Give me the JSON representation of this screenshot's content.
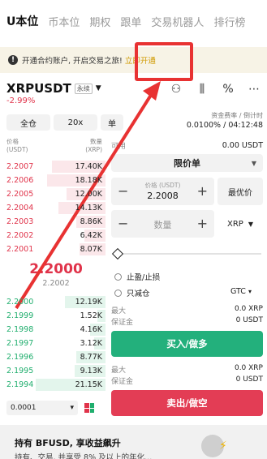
{
  "tabs": [
    "U本位",
    "币本位",
    "期权",
    "跟单",
    "交易机器人",
    "排行榜"
  ],
  "notice": {
    "text": "开通合约账户, 开启交易之旅!",
    "link": "立即开通"
  },
  "pair": {
    "symbol": "XRPUSDT",
    "type": "永续",
    "change": "-2.99%"
  },
  "controls": {
    "margin_mode": "全仓",
    "leverage": "20x",
    "position_mode": "单"
  },
  "funding": {
    "label": "资金费率 / 倒计时",
    "value": "0.0100% / 04:12:48"
  },
  "balance": {
    "label": "可用",
    "value": "0.00 USDT"
  },
  "orderbook": {
    "price_header": "价格",
    "price_unit": "(USDT)",
    "qty_header": "数量",
    "qty_unit": "(XRP)",
    "asks": [
      {
        "price": "2.2007",
        "qty": "17.40K",
        "depth": 0.55
      },
      {
        "price": "2.2006",
        "qty": "18.18K",
        "depth": 0.6
      },
      {
        "price": "2.2005",
        "qty": "12.00K",
        "depth": 0.4
      },
      {
        "price": "2.2004",
        "qty": "14.13K",
        "depth": 0.48
      },
      {
        "price": "2.2003",
        "qty": "8.86K",
        "depth": 0.3
      },
      {
        "price": "2.2002",
        "qty": "6.42K",
        "depth": 0.22
      },
      {
        "price": "2.2001",
        "qty": "8.07K",
        "depth": 0.27
      }
    ],
    "last_price": "2.2000",
    "mark_price": "2.2002",
    "bids": [
      {
        "price": "2.2000",
        "qty": "12.19K",
        "depth": 0.42
      },
      {
        "price": "2.1999",
        "qty": "1.52K",
        "depth": 0.08
      },
      {
        "price": "2.1998",
        "qty": "4.16K",
        "depth": 0.16
      },
      {
        "price": "2.1997",
        "qty": "3.12K",
        "depth": 0.12
      },
      {
        "price": "2.1996",
        "qty": "8.77K",
        "depth": 0.3
      },
      {
        "price": "2.1995",
        "qty": "9.13K",
        "depth": 0.32
      },
      {
        "price": "2.1994",
        "qty": "21.15K",
        "depth": 0.72
      }
    ],
    "precision": "0.0001"
  },
  "order_form": {
    "order_type": "限价单",
    "price_label": "价格 (USDT)",
    "price_value": "2.2008",
    "best_price": "最优价",
    "qty_placeholder": "数量",
    "qty_unit": "XRP",
    "tp_sl": "止盈/止损",
    "reduce_only": "只减仓",
    "time_in_force": "GTC",
    "buy_max_label": "最大",
    "buy_max_value": "0.0 XRP",
    "buy_margin_label": "保证金",
    "buy_margin_value": "0 USDT",
    "buy_button": "买入/做多",
    "sell_max_label": "最大",
    "sell_max_value": "0.0 XRP",
    "sell_margin_label": "保证金",
    "sell_margin_value": "0 USDT",
    "sell_button": "卖出/做空"
  },
  "promo": {
    "title": "持有 BFUSD, 享收益飙升",
    "subtitle": "持有、交易, 并享受 8% 及以上的年化..."
  },
  "icons": [
    "info-icon",
    "chevron-down-icon",
    "candlestick-icon",
    "percent-icon",
    "more-icon",
    "coin-icon",
    "bolt-icon"
  ],
  "colors": {
    "red": "#e0334a",
    "green": "#1fae6d",
    "buy": "#23b07c",
    "sell": "#e33d55",
    "accent": "#d09a00",
    "annotation": "#e83232"
  }
}
